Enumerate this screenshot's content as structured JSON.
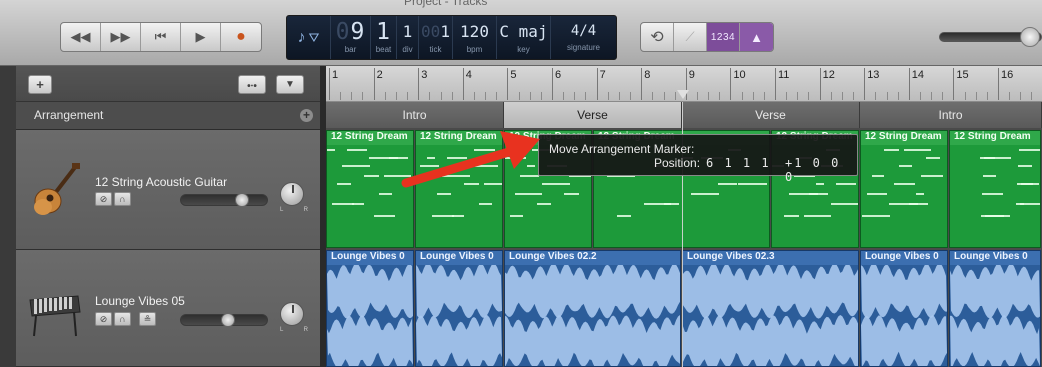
{
  "window": {
    "title": "Project - Tracks"
  },
  "colors": {
    "midi_region": "#1d9a3a",
    "audio_region": "#2c5d9a",
    "arrow": "#e8321f",
    "lcd": "#0f1a2a",
    "accent": "#8a5aa8"
  },
  "transport": {
    "buttons": [
      {
        "name": "rewind-icon",
        "glyph": "◀◀"
      },
      {
        "name": "fast-forward-icon",
        "glyph": "▶▶"
      },
      {
        "name": "go-to-start-icon",
        "glyph": "⏮"
      },
      {
        "name": "play-icon",
        "glyph": "▶"
      },
      {
        "name": "record-icon",
        "glyph": "●"
      }
    ]
  },
  "lcd": {
    "bar": "9",
    "bar_label": "bar",
    "beat": "1",
    "beat_label": "beat",
    "div": "1",
    "div_label": "div",
    "tick": "1",
    "tick_label": "tick",
    "bpm": "120",
    "bpm_label": "bpm",
    "key": "C maj",
    "key_label": "key",
    "signature": "4/4",
    "signature_label": "signature"
  },
  "right_controls": {
    "count_in": "1234"
  },
  "track_header": {
    "arrangement_label": "Arrangement"
  },
  "tracks": [
    {
      "name": "12 String Acoustic Guitar",
      "icon": "acoustic-guitar-icon"
    },
    {
      "name": "Lounge Vibes 05",
      "icon": "vibraphone-icon"
    }
  ],
  "ruler": {
    "bars": [
      "1",
      "2",
      "3",
      "4",
      "5",
      "6",
      "7",
      "8",
      "9",
      "10",
      "11",
      "12",
      "13",
      "14",
      "15",
      "16"
    ]
  },
  "arrangement_markers": [
    {
      "label": "Intro",
      "selected": false
    },
    {
      "label": "Verse",
      "selected": true
    },
    {
      "label": "Verse",
      "selected": false
    },
    {
      "label": "Intro",
      "selected": false
    }
  ],
  "midi_regions": [
    "12 String Dream",
    "12 String Dream",
    "12 String Dream",
    "12 String Dream",
    "12 String Dream",
    "12 String Dream",
    "12 String Dream",
    "12 String Dream"
  ],
  "audio_regions": [
    "Lounge Vibes 0",
    "Lounge Vibes 0",
    "Lounge Vibes 02.2",
    "Lounge Vibes 02.3",
    "Lounge Vibes 0",
    "Lounge Vibes 0"
  ],
  "tooltip": {
    "title": "Move Arrangement Marker:",
    "position_label": "Position:",
    "position": "6 1 1 1",
    "delta": "+1 0 0 0"
  }
}
